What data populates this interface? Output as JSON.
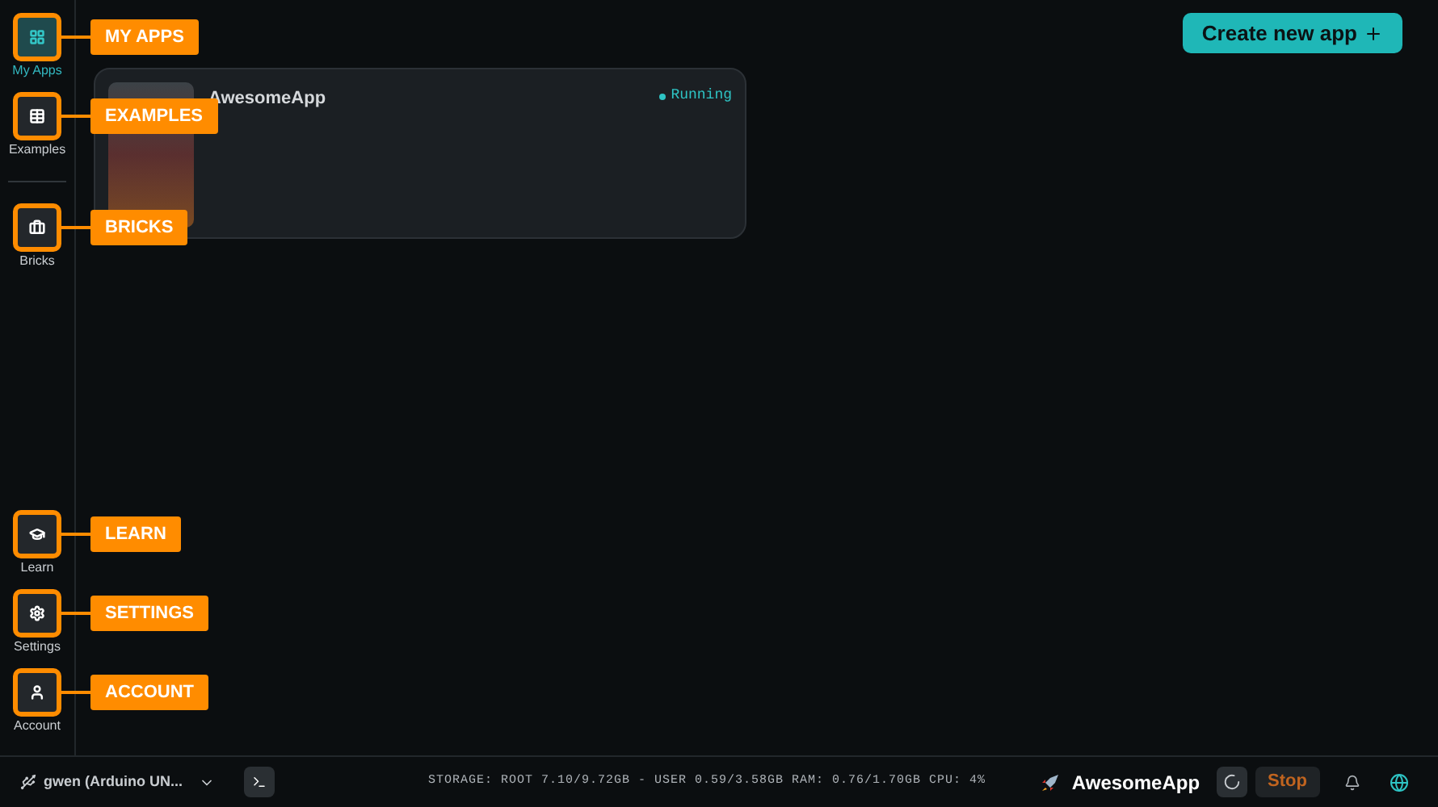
{
  "header": {
    "create_button": "Create new app"
  },
  "sidebar": {
    "top_items": [
      {
        "label": "My Apps",
        "kind": "grid",
        "selected": true,
        "callout": "MY APPS"
      },
      {
        "label": "Examples",
        "kind": "table",
        "selected": false,
        "callout": "EXAMPLES"
      }
    ],
    "middle_items": [
      {
        "label": "Bricks",
        "kind": "brick",
        "selected": false,
        "callout": "BRICKS"
      }
    ],
    "bottom_items": [
      {
        "label": "Learn",
        "kind": "cap",
        "selected": false,
        "callout": "LEARN"
      },
      {
        "label": "Settings",
        "kind": "gear",
        "selected": false,
        "callout": "SETTINGS"
      },
      {
        "label": "Account",
        "kind": "user",
        "selected": false,
        "callout": "ACCOUNT"
      }
    ]
  },
  "apps": [
    {
      "name": "AwesomeApp",
      "status": "Running",
      "running": true
    }
  ],
  "status_bar": {
    "board": "gwen (Arduino UN...",
    "stats": "STORAGE: ROOT 7.10/9.72GB - USER 0.59/3.58GB RAM: 0.76/1.70GB CPU: 4%",
    "app_name": "AwesomeApp",
    "stop_button": "Stop"
  }
}
